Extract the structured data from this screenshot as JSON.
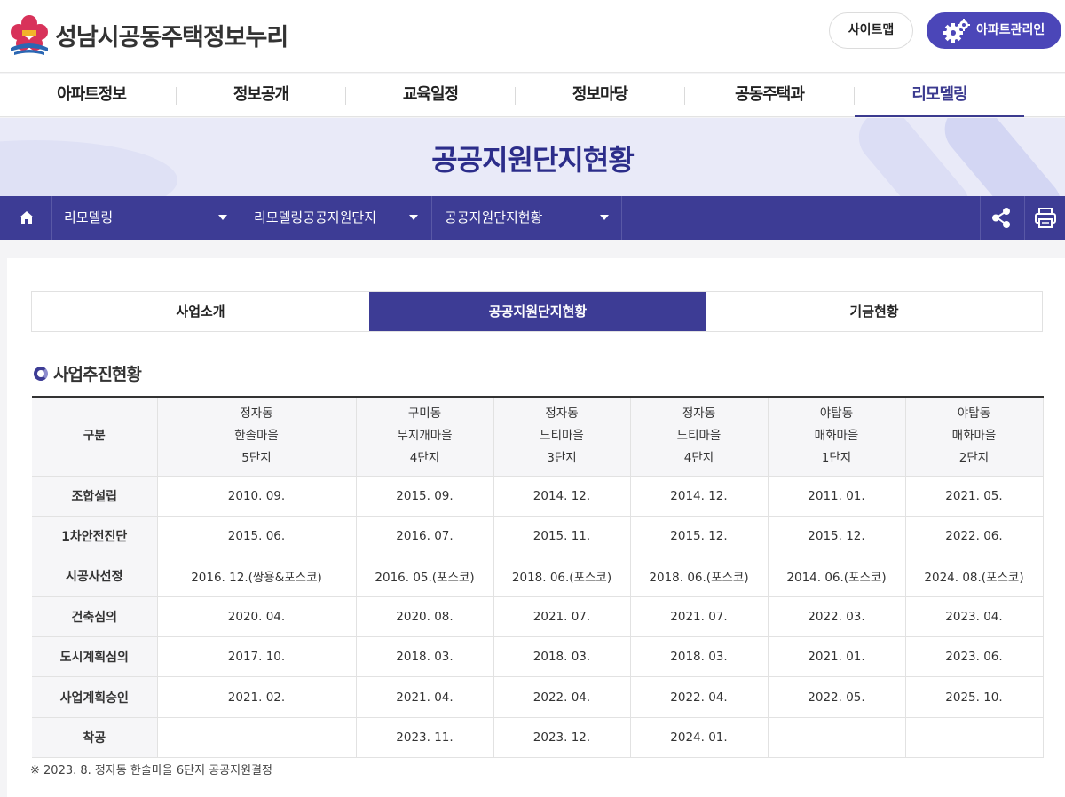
{
  "header": {
    "site_title": "성남시공동주택정보누리",
    "sitemap_label": "사이트맵",
    "admin_label": "아파트관리인"
  },
  "gnb": {
    "items": [
      {
        "label": "아파트정보"
      },
      {
        "label": "정보공개"
      },
      {
        "label": "교육일정"
      },
      {
        "label": "정보마당"
      },
      {
        "label": "공동주택과"
      },
      {
        "label": "리모델링",
        "active": true
      }
    ]
  },
  "banner": {
    "title": "공공지원단지현황"
  },
  "breadcrumb": {
    "items": [
      "리모델링",
      "리모델링공공지원단지",
      "공공지원단지현황"
    ]
  },
  "tabs": [
    {
      "label": "사업소개"
    },
    {
      "label": "공공지원단지현황",
      "active": true
    },
    {
      "label": "기금현황"
    }
  ],
  "section": {
    "title": "사업추진현황"
  },
  "table": {
    "corner": "구분",
    "columns": [
      [
        "정자동",
        "한솔마을",
        "5단지"
      ],
      [
        "구미동",
        "무지개마을",
        "4단지"
      ],
      [
        "정자동",
        "느티마을",
        "3단지"
      ],
      [
        "정자동",
        "느티마을",
        "4단지"
      ],
      [
        "야탑동",
        "매화마을",
        "1단지"
      ],
      [
        "야탑동",
        "매화마을",
        "2단지"
      ]
    ],
    "rows": [
      {
        "label": "조합설립",
        "values": [
          "2010. 09.",
          "2015. 09.",
          "2014. 12.",
          "2014. 12.",
          "2011. 01.",
          "2021. 05."
        ]
      },
      {
        "label": "1차안전진단",
        "values": [
          "2015. 06.",
          "2016. 07.",
          "2015. 11.",
          "2015. 12.",
          "2015. 12.",
          "2022. 06."
        ]
      },
      {
        "label": "시공사선정",
        "values": [
          "2016. 12.(쌍용&포스코)",
          "2016. 05.(포스코)",
          "2018. 06.(포스코)",
          "2018. 06.(포스코)",
          "2014. 06.(포스코)",
          "2024. 08.(포스코)"
        ]
      },
      {
        "label": "건축심의",
        "values": [
          "2020. 04.",
          "2020. 08.",
          "2021. 07.",
          "2021. 07.",
          "2022. 03.",
          "2023. 04."
        ]
      },
      {
        "label": "도시계획심의",
        "values": [
          "2017. 10.",
          "2018. 03.",
          "2018. 03.",
          "2018. 03.",
          "2021. 01.",
          "2023. 06."
        ]
      },
      {
        "label": "사업계획승인",
        "values": [
          "2021. 02.",
          "2021. 04.",
          "2022. 04.",
          "2022. 04.",
          "2022. 05.",
          "2025. 10."
        ]
      },
      {
        "label": "착공",
        "values": [
          "",
          "2023. 11.",
          "2023. 12.",
          "2024. 01.",
          "",
          ""
        ]
      }
    ]
  },
  "note": "※ 2023. 8. 정자동 한솔마을 6단지 공공지원결정",
  "colors": {
    "primary": "#3d3c95",
    "admin_button": "#4b46b8",
    "banner_bg": "#e9eaf8"
  },
  "icons": {
    "logo": "seongnam-city-emblem",
    "admin": "gear-icon",
    "home": "home-icon",
    "share": "share-icon",
    "print": "print-icon"
  }
}
